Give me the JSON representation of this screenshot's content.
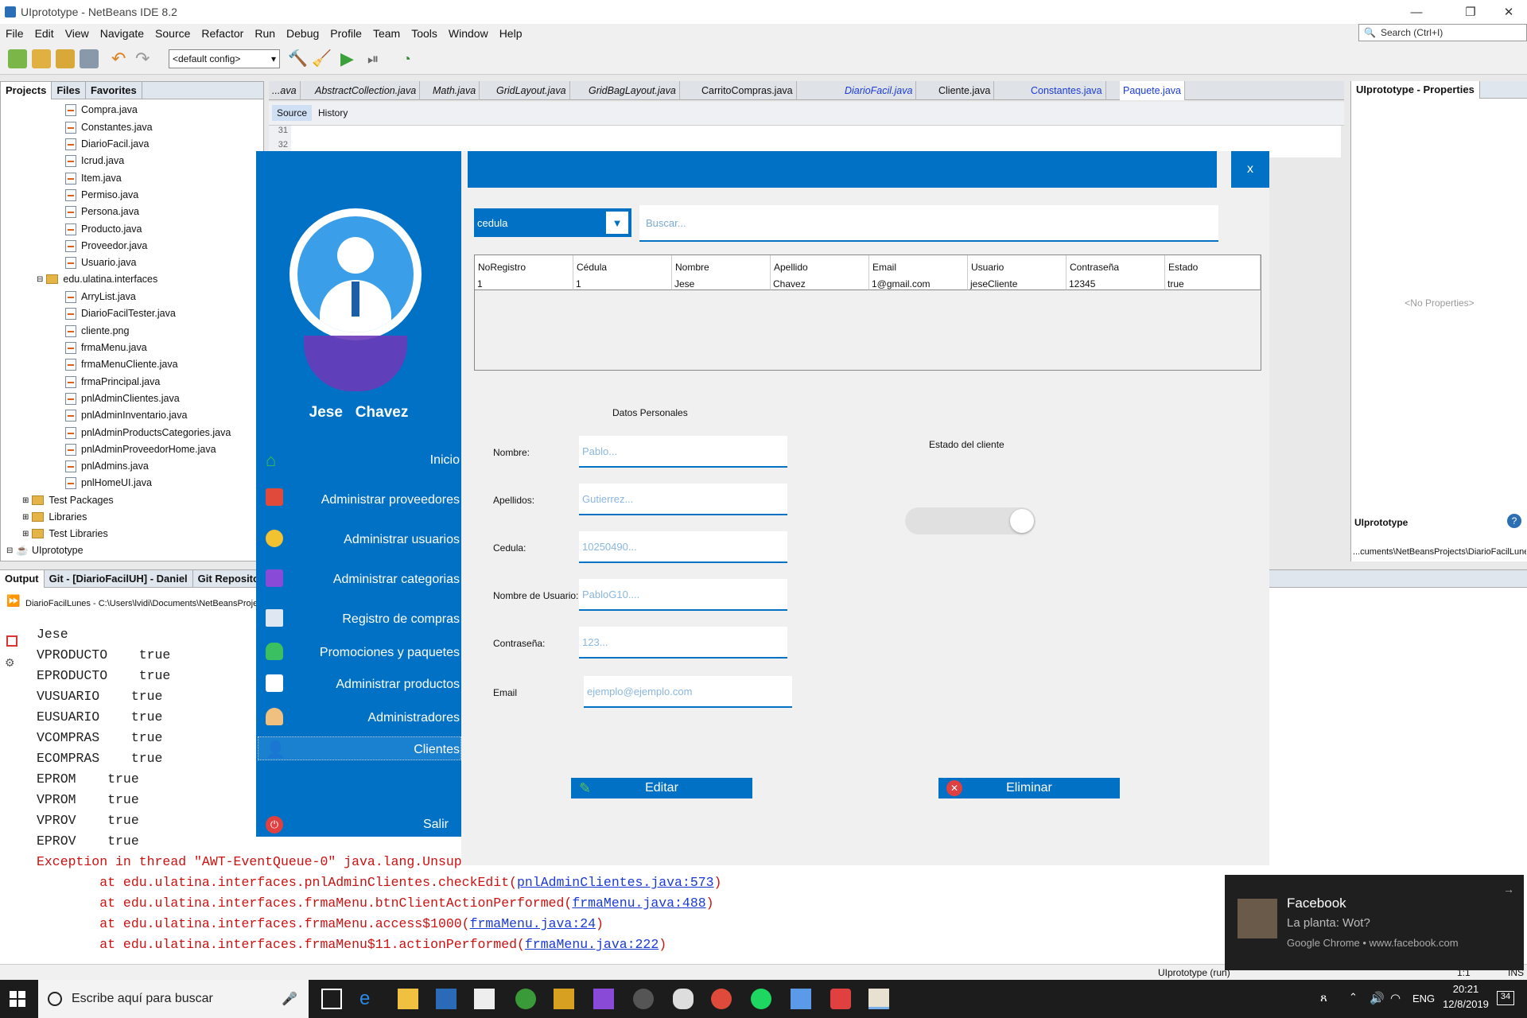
{
  "window": {
    "title": "UIprototype - NetBeans IDE 8.2"
  },
  "menu": [
    "File",
    "Edit",
    "View",
    "Navigate",
    "Source",
    "Refactor",
    "Run",
    "Debug",
    "Profile",
    "Team",
    "Tools",
    "Window",
    "Help"
  ],
  "search": {
    "placeholder": "Search (Ctrl+I)"
  },
  "toolbar": {
    "config": "<default config>"
  },
  "projects": {
    "tabs": [
      "Projects",
      "Files",
      "Favorites"
    ],
    "items": [
      "Compra.java",
      "Constantes.java",
      "DiarioFacil.java",
      "Icrud.java",
      "Item.java",
      "Permiso.java",
      "Persona.java",
      "Producto.java",
      "Proveedor.java",
      "Usuario.java"
    ],
    "package": "edu.ulatina.interfaces",
    "package_items": [
      "ArryList.java",
      "DiarioFacilTester.java",
      "cliente.png",
      "frmaMenu.java",
      "frmaMenuCliente.java",
      "frmaPrincipal.java",
      "pnlAdminClientes.java",
      "pnlAdminInventario.java",
      "pnlAdminProductsCategories.java",
      "pnlAdminProveedorHome.java",
      "pnlAdmins.java",
      "pnlHomeUI.java"
    ],
    "folders": [
      "Test Packages",
      "Libraries",
      "Test Libraries"
    ],
    "root": "UIprototype"
  },
  "editor": {
    "tabs": [
      "...ava",
      "AbstractCollection.java",
      "Math.java",
      "GridLayout.java",
      "GridBagLayout.java",
      "CarritoCompras.java",
      "DiarioFacil.java",
      "Cliente.java",
      "Constantes.java",
      "Paquete.java"
    ],
    "source_tab": "Source",
    "history_tab": "History",
    "line_numbers": [
      "31",
      "32"
    ]
  },
  "properties": {
    "title": "UIprototype - Properties",
    "empty": "<No Properties>",
    "footer_title": "UIprototype",
    "path": "...cuments\\NetBeansProjects\\DiarioFacilLunes"
  },
  "output": {
    "tabs": [
      "Output",
      "Git - [DiarioFacilUH] - Daniel",
      "Git Repository"
    ],
    "run_label": "DiarioFacilLunes - C:\\Users\\lvidi\\Documents\\NetBeansProje",
    "lines": [
      "Jese",
      "VPRODUCTO    true",
      "EPRODUCTO    true",
      "VUSUARIO    true",
      "EUSUARIO    true",
      "VCOMPRAS    true",
      "ECOMPRAS    true",
      "EPROM    true",
      "VPROM    true",
      "VPROV    true",
      "EPROV    true"
    ],
    "exception": "Exception in thread \"AWT-EventQueue-0\" java.lang.Unsup",
    "stack": [
      {
        "text": "        at edu.ulatina.interfaces.pnlAdminClientes.checkEdit(",
        "link": "pnlAdminClientes.java:573",
        "end": ")"
      },
      {
        "text": "        at edu.ulatina.interfaces.frmaMenu.btnClientActionPerformed(",
        "link": "frmaMenu.java:488",
        "end": ")"
      },
      {
        "text": "        at edu.ulatina.interfaces.frmaMenu.access$1000(",
        "link": "frmaMenu.java:24",
        "end": ")"
      },
      {
        "text": "        at edu.ulatina.interfaces.frmaMenu$11.actionPerformed(",
        "link": "frmaMenu.java:222",
        "end": ")"
      }
    ]
  },
  "app": {
    "user_first": "Jese",
    "user_last": "Chavez",
    "nav": [
      "Inicio",
      "Administrar proveedores",
      "Administrar usuarios",
      "Administrar categorias",
      "Registro de compras",
      "Promociones y paquetes",
      "Administrar productos",
      "Administradores",
      "Clientes",
      "Salir"
    ],
    "close": "x",
    "filter_select": "cedula",
    "search_placeholder": "Buscar...",
    "table": {
      "headers": [
        "NoRegistro",
        "Cédula",
        "Nombre",
        "Apellido",
        "Email",
        "Usuario",
        "Contraseña",
        "Estado"
      ],
      "rows": [
        [
          "1",
          "1",
          "Jese",
          "Chavez",
          "1@gmail.com",
          "jeseCliente",
          "12345",
          "true"
        ]
      ]
    },
    "section_title": "Datos Personales",
    "estado_label": "Estado del cliente",
    "fields": [
      {
        "label": "Nombre:",
        "placeholder": "Pablo..."
      },
      {
        "label": "Apellidos:",
        "placeholder": "Gutierrez..."
      },
      {
        "label": "Cedula:",
        "placeholder": "10250490..."
      },
      {
        "label": "Nombre de Usuario:",
        "placeholder": "PabloG10...."
      },
      {
        "label": "Contraseña:",
        "placeholder": "123..."
      },
      {
        "label": "Email",
        "placeholder": "ejemplo@ejemplo.com"
      }
    ],
    "edit_button": "Editar",
    "delete_button": "Eliminar",
    "colors": {
      "primary": "#0071c5"
    }
  },
  "notification": {
    "app": "Facebook",
    "message": "La planta: Wot?",
    "source": "Google Chrome • www.facebook.com"
  },
  "status": {
    "project": "UIprototype (run)",
    "pos": "1:1",
    "mode": "INS"
  },
  "taskbar": {
    "search": "Escribe aquí para buscar",
    "time": "20:21",
    "date": "12/8/2019",
    "lang": "ENG",
    "notif_count": "34"
  }
}
